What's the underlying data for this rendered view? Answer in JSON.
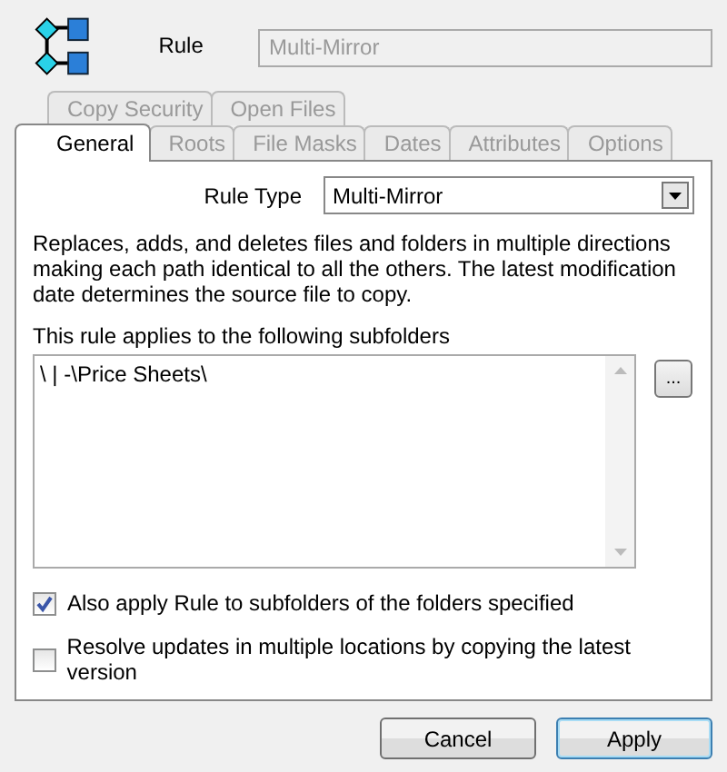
{
  "header": {
    "label": "Rule",
    "name_field": {
      "value": "Multi-Mirror",
      "disabled": true
    }
  },
  "tab_rows": [
    [
      {
        "label": "Copy Security",
        "selected": false
      },
      {
        "label": "Open Files",
        "selected": false
      }
    ],
    [
      {
        "label": "General",
        "selected": true
      },
      {
        "label": "Roots",
        "selected": false
      },
      {
        "label": "File Masks",
        "selected": false
      },
      {
        "label": "Dates",
        "selected": false
      },
      {
        "label": "Attributes",
        "selected": false
      },
      {
        "label": "Options",
        "selected": false
      }
    ]
  ],
  "rule_type": {
    "label": "Rule Type",
    "value": "Multi-Mirror"
  },
  "description": "Replaces, adds, and deletes files and folders in multiple directions making each path identical to all the others. The latest modification date determines the source file to copy.",
  "subfolders": {
    "label": "This rule applies to the following subfolders",
    "value": "\\ | -\\Price Sheets\\",
    "browse": "..."
  },
  "options": [
    {
      "label": "Also apply Rule to subfolders of the folders specified",
      "checked": true
    },
    {
      "label": "Resolve updates in multiple locations by copying the latest version",
      "checked": false
    }
  ],
  "buttons": [
    {
      "label": "Cancel",
      "default": false
    },
    {
      "label": "Apply",
      "default": true
    }
  ]
}
